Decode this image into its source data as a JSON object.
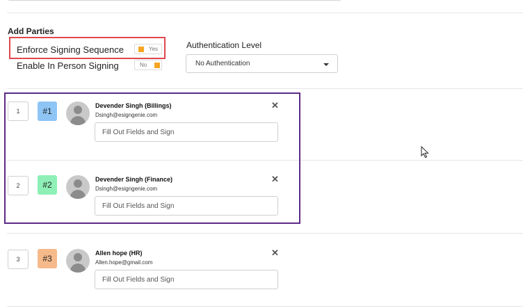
{
  "section_title": "Add Parties",
  "options": {
    "enforce": {
      "label": "Enforce Signing Sequence",
      "toggle": "Yes"
    },
    "in_person": {
      "label": "Enable In Person Signing",
      "toggle": "No"
    }
  },
  "auth": {
    "label": "Authentication Level",
    "value": "No Authentication"
  },
  "parties": [
    {
      "order": "1",
      "badge": "#1",
      "badge_color": "#8ec5f5",
      "name": "Devender Singh (Billings)",
      "email": "Dsingh@esigngenie.com",
      "role_placeholder": "Fill Out Fields and Sign"
    },
    {
      "order": "2",
      "badge": "#2",
      "badge_color": "#8ef0b6",
      "name": "Devender Singh (Finance)",
      "email": "Dsingh@esigngenie.com",
      "role_placeholder": "Fill Out Fields and Sign"
    },
    {
      "order": "3",
      "badge": "#3",
      "badge_color": "#f6b98a",
      "name": "Allen hope (HR)",
      "email": "Allen.hope@gmail.com",
      "role_placeholder": "Fill Out Fields and Sign"
    }
  ],
  "remove_icon": "close-icon",
  "colors": {
    "highlight_red": "#e0474c",
    "highlight_purple": "#5b2a86",
    "toggle_accent": "#f5a623"
  }
}
